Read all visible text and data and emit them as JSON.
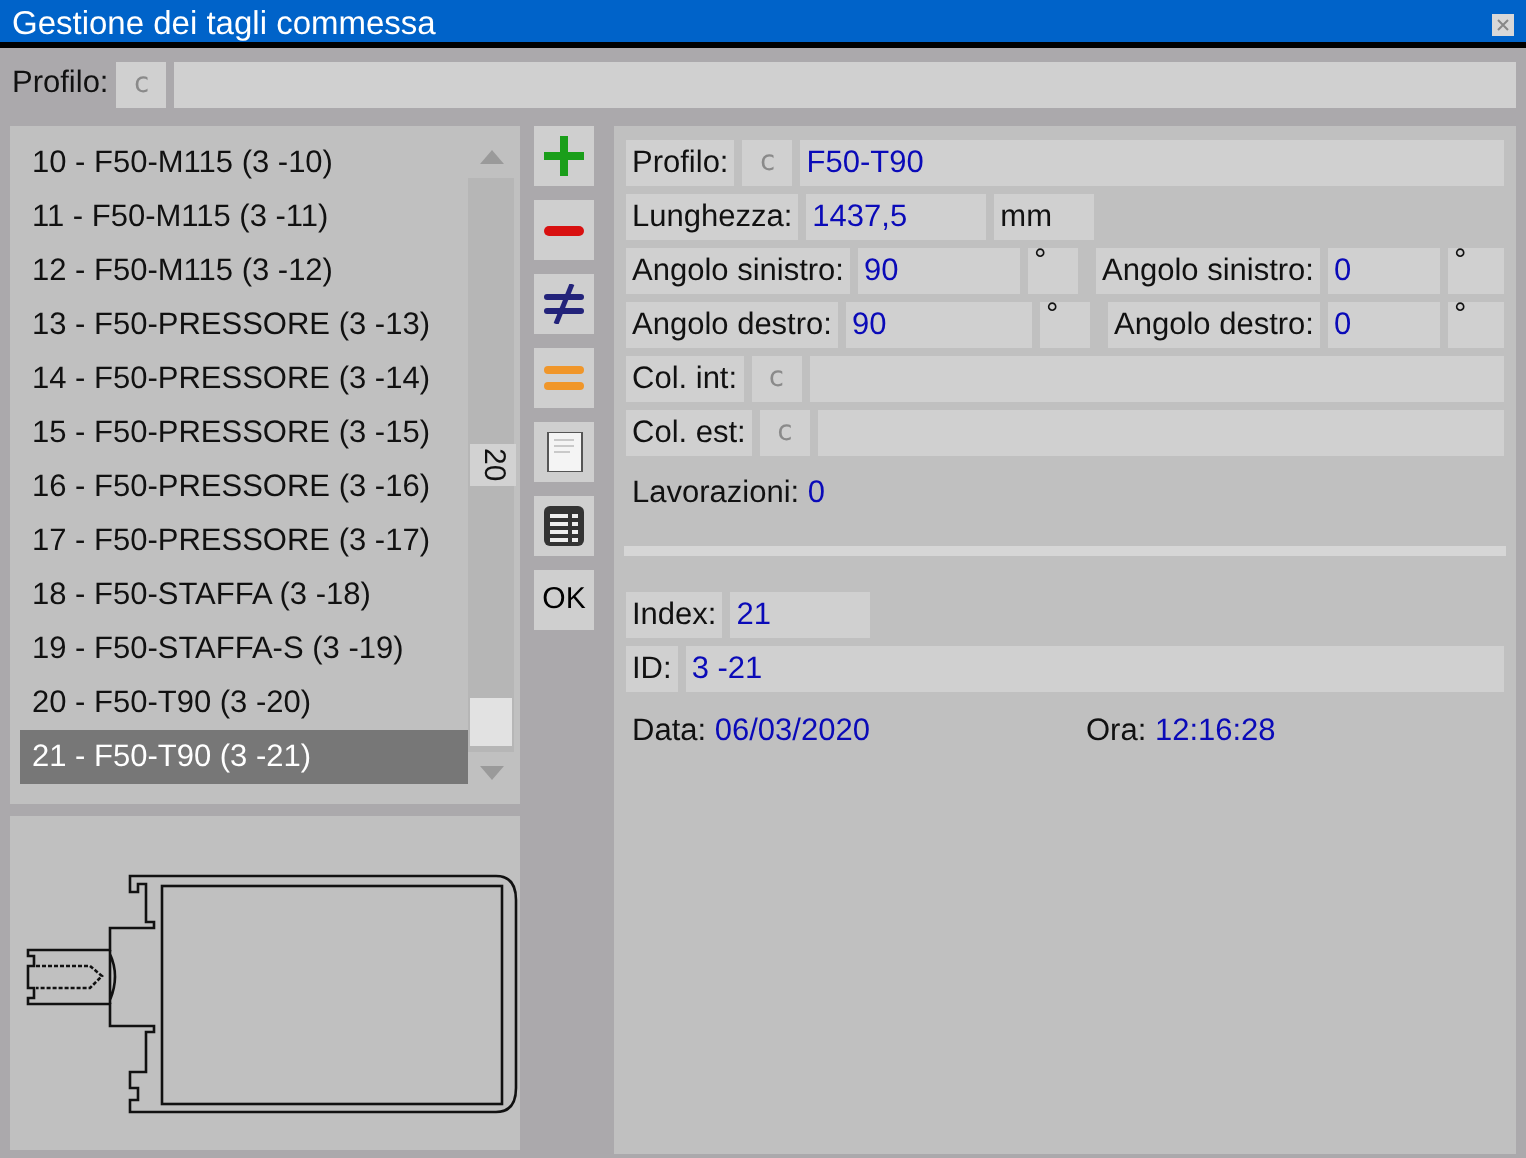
{
  "window": {
    "title": "Gestione dei tagli commessa"
  },
  "profile_bar": {
    "label": "Profilo:",
    "code": "c"
  },
  "list": {
    "items": [
      {
        "label": "10 - F50-M115 (3 -10)",
        "selected": false
      },
      {
        "label": "11 - F50-M115 (3 -11)",
        "selected": false
      },
      {
        "label": "12 - F50-M115 (3 -12)",
        "selected": false
      },
      {
        "label": "13 - F50-PRESSORE (3 -13)",
        "selected": false
      },
      {
        "label": "14 - F50-PRESSORE (3 -14)",
        "selected": false
      },
      {
        "label": "15 - F50-PRESSORE (3 -15)",
        "selected": false
      },
      {
        "label": "16 - F50-PRESSORE (3 -16)",
        "selected": false
      },
      {
        "label": "17 - F50-PRESSORE (3 -17)",
        "selected": false
      },
      {
        "label": "18 - F50-STAFFA (3 -18)",
        "selected": false
      },
      {
        "label": "19 - F50-STAFFA-S (3 -19)",
        "selected": false
      },
      {
        "label": "20 - F50-T90 (3 -20)",
        "selected": false
      },
      {
        "label": "21 - F50-T90 (3 -21)",
        "selected": true
      }
    ],
    "counter": "20"
  },
  "toolbar": [
    {
      "kind": "add"
    },
    {
      "kind": "remove"
    },
    {
      "kind": "differ"
    },
    {
      "kind": "equal"
    },
    {
      "kind": "document"
    },
    {
      "kind": "table"
    },
    {
      "kind": "text",
      "label": "OK"
    }
  ],
  "details": {
    "profilo": {
      "label": "Profilo:",
      "code": "c",
      "value": "F50-T90"
    },
    "lunghezza": {
      "label": "Lunghezza:",
      "value": "1437,5",
      "unit": "mm"
    },
    "angles": [
      [
        {
          "label": "Angolo sinistro:",
          "value": "90",
          "unit": "°"
        },
        {
          "label": "Angolo sinistro:",
          "value": "0",
          "unit": "°"
        }
      ],
      [
        {
          "label": "Angolo destro:",
          "value": "90",
          "unit": "°"
        },
        {
          "label": "Angolo destro:",
          "value": "0",
          "unit": "°"
        }
      ]
    ],
    "colors": [
      {
        "label": "Col. int:",
        "code": "c"
      },
      {
        "label": "Col. est:",
        "code": "c"
      }
    ],
    "lavorazioni": {
      "label": "Lavorazioni:",
      "value": "0"
    },
    "index": {
      "label": "Index:",
      "value": "21"
    },
    "id": {
      "label": "ID:",
      "value": "3 -21"
    },
    "data": {
      "label": "Data:",
      "value": "06/03/2020"
    },
    "ora": {
      "label": "Ora:",
      "value": "12:16:28"
    }
  }
}
